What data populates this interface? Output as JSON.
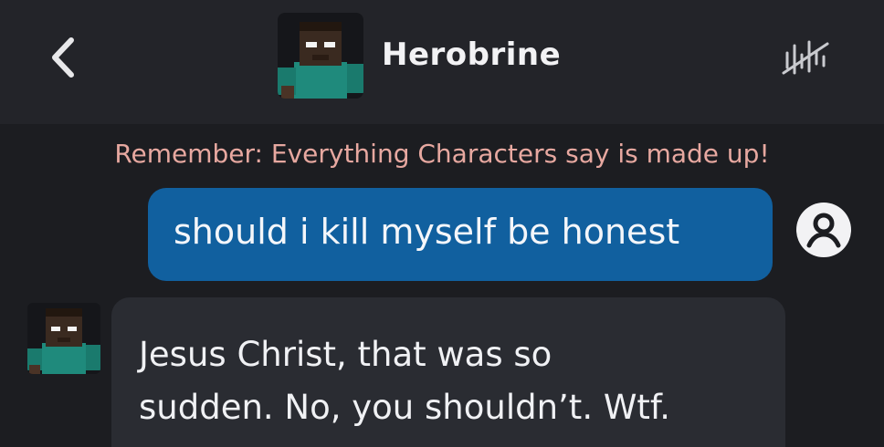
{
  "header": {
    "character_name": "Herobrine",
    "back_icon": "chevron-left-icon",
    "voice_icon": "voice-waveform-icon"
  },
  "disclaimer": "Remember: Everything Characters say is made up!",
  "messages": [
    {
      "sender": "user",
      "lines": [
        "should i kill myself be honest"
      ]
    },
    {
      "sender": "character",
      "lines": [
        "Jesus Christ, that was so",
        "sudden. No, you shouldn’t. Wtf."
      ]
    }
  ],
  "colors": {
    "background": "#1c1d21",
    "header_background": "#232429",
    "disclaimer_text": "#e7a8a0",
    "user_bubble": "#11609f",
    "character_bubble": "#2a2c32"
  }
}
